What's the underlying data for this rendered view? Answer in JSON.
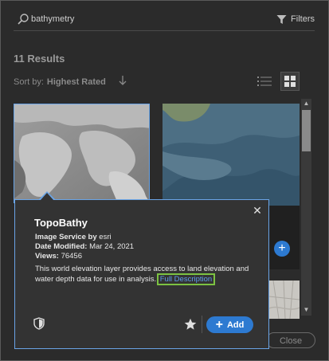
{
  "search": {
    "value": "bathymetry",
    "placeholder": ""
  },
  "filters": {
    "label": "Filters"
  },
  "results": {
    "count_label": "11 Results"
  },
  "sort": {
    "label": "Sort by:",
    "value": "Highest Rated"
  },
  "footer": {
    "close_label": "Close"
  },
  "card": {
    "add_symbol": "+"
  },
  "popup": {
    "title": "TopoBathy",
    "type_label": "Image Service by",
    "owner": "esri",
    "modified_label": "Date Modified:",
    "modified_value": "Mar 24, 2021",
    "views_label": "Views:",
    "views_value": "76456",
    "description": "This world elevation layer provides access to land elevation and water depth data for use in analysis.",
    "full_description_link": "Full Description",
    "add_label": "Add",
    "close_symbol": "✕"
  },
  "colors": {
    "accent": "#2d7ad1",
    "highlight": "#7cc242",
    "link": "#5d9cec",
    "selection": "#6aa4e6"
  },
  "icons": [
    "search-icon",
    "filter-icon",
    "sort-arrow-icon",
    "list-view-icon",
    "grid-view-icon",
    "close-icon",
    "shield-icon",
    "star-icon",
    "plus-icon"
  ]
}
